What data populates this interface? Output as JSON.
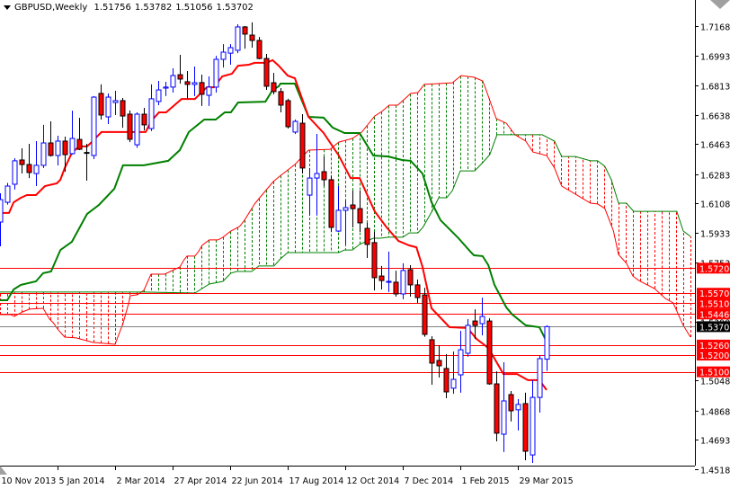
{
  "header": {
    "symbol_timeframe": "GBPUSD,Weekly",
    "open": "1.51756",
    "high": "1.53782",
    "low": "1.51056",
    "close": "1.53702"
  },
  "colors": {
    "bull": "#0000ff",
    "bear_fill": "#ff0000",
    "bear_outline": "#000000",
    "tenkan": "#ff0000",
    "kijun": "#008000",
    "span_a": "#ff0000",
    "span_b": "#008000",
    "level_line": "#ff0000",
    "current_price_line": "#808080",
    "current_price_label": "#000000"
  },
  "chart_data": {
    "type": "candlestick",
    "title": "GBPUSD,Weekly",
    "x_unit": "week index (0 = week of 10 Nov 2013)",
    "ylim": [
      1.4518,
      1.7168
    ],
    "grid": false,
    "x_labels": [
      {
        "week": 0,
        "label": "10 Nov 2013"
      },
      {
        "week": 8,
        "label": "5 Jan 2014"
      },
      {
        "week": 16,
        "label": "2 Mar 2014"
      },
      {
        "week": 24,
        "label": "27 Apr 2014"
      },
      {
        "week": 32,
        "label": "22 Jun 2014"
      },
      {
        "week": 40,
        "label": "17 Aug 2014"
      },
      {
        "week": 48,
        "label": "12 Oct 2014"
      },
      {
        "week": 56,
        "label": "7 Dec 2014"
      },
      {
        "week": 64,
        "label": "1 Feb 2015"
      },
      {
        "week": 72,
        "label": "29 Mar 2015"
      }
    ],
    "y_ticks": [
      "1.71680",
      "1.69930",
      "1.68130",
      "1.66380",
      "1.64630",
      "1.62830",
      "1.61080",
      "1.59330",
      "1.57530",
      "1.53980",
      "1.50480",
      "1.48680",
      "1.46930",
      "1.45180"
    ],
    "candles_ohlc": [
      [
        1.5996,
        1.6168,
        1.5851,
        1.613
      ],
      [
        1.6114,
        1.623,
        1.61,
        1.6211
      ],
      [
        1.6222,
        1.6378,
        1.619,
        1.6362
      ],
      [
        1.6367,
        1.6437,
        1.6286,
        1.634
      ],
      [
        1.634,
        1.6464,
        1.6259,
        1.6292
      ],
      [
        1.6286,
        1.648,
        1.6211,
        1.6335
      ],
      [
        1.6335,
        1.6577,
        1.6319,
        1.6469
      ],
      [
        1.6469,
        1.6598,
        1.6388,
        1.6394
      ],
      [
        1.6394,
        1.6512,
        1.6335,
        1.648
      ],
      [
        1.648,
        1.6507,
        1.6297,
        1.6399
      ],
      [
        1.6405,
        1.6662,
        1.6399,
        1.6496
      ],
      [
        1.649,
        1.6619,
        1.6426,
        1.6431
      ],
      [
        1.6412,
        1.6464,
        1.6243,
        1.6408
      ],
      [
        1.6394,
        1.6749,
        1.6372,
        1.6743
      ],
      [
        1.6765,
        1.6819,
        1.6609,
        1.6636
      ],
      [
        1.6625,
        1.6765,
        1.6582,
        1.6743
      ],
      [
        1.6711,
        1.6781,
        1.6636,
        1.6722
      ],
      [
        1.6722,
        1.6738,
        1.656,
        1.663
      ],
      [
        1.6641,
        1.6663,
        1.6474,
        1.6491
      ],
      [
        1.6458,
        1.6652,
        1.644,
        1.6641
      ],
      [
        1.6641,
        1.6679,
        1.6544,
        1.6577
      ],
      [
        1.6555,
        1.6819,
        1.654,
        1.6733
      ],
      [
        1.6717,
        1.684,
        1.6695,
        1.6786
      ],
      [
        1.6797,
        1.6835,
        1.6749,
        1.6803
      ],
      [
        1.6803,
        1.6915,
        1.677,
        1.6872
      ],
      [
        1.6877,
        1.6996,
        1.6824,
        1.6851
      ],
      [
        1.6835,
        1.6899,
        1.6733,
        1.6819
      ],
      [
        1.6819,
        1.6926,
        1.6749,
        1.6829
      ],
      [
        1.683,
        1.6878,
        1.669,
        1.676
      ],
      [
        1.6754,
        1.6867,
        1.669,
        1.6803
      ],
      [
        1.6803,
        1.699,
        1.677,
        1.6969
      ],
      [
        1.6969,
        1.706,
        1.692,
        1.7012
      ],
      [
        1.7006,
        1.706,
        1.6937,
        1.7039
      ],
      [
        1.7023,
        1.7179,
        1.7006,
        1.7163
      ],
      [
        1.7163,
        1.7168,
        1.7033,
        1.712
      ],
      [
        1.7114,
        1.719,
        1.7039,
        1.7082
      ],
      [
        1.7082,
        1.7103,
        1.6969,
        1.6974
      ],
      [
        1.6974,
        1.7001,
        1.6786,
        1.6808
      ],
      [
        1.6829,
        1.6888,
        1.676,
        1.6776
      ],
      [
        1.6776,
        1.6797,
        1.6652,
        1.6695
      ],
      [
        1.6722,
        1.6733,
        1.6555,
        1.6566
      ],
      [
        1.6534,
        1.6609,
        1.6523,
        1.6598
      ],
      [
        1.6587,
        1.6641,
        1.6286,
        1.6319
      ],
      [
        1.6157,
        1.6319,
        1.6034,
        1.6259
      ],
      [
        1.6259,
        1.6523,
        1.6034,
        1.6286
      ],
      [
        1.6297,
        1.6388,
        1.6211,
        1.6249
      ],
      [
        1.6249,
        1.6275,
        1.5937,
        1.5964
      ],
      [
        1.5942,
        1.6211,
        1.5937,
        1.6066
      ],
      [
        1.6066,
        1.6125,
        1.5862,
        1.6082
      ],
      [
        1.6098,
        1.6184,
        1.5964,
        1.6076
      ],
      [
        1.6076,
        1.6184,
        1.5937,
        1.5991
      ],
      [
        1.5958,
        1.5991,
        1.5781,
        1.5862
      ],
      [
        1.5873,
        1.5937,
        1.5587,
        1.5663
      ],
      [
        1.5673,
        1.5733,
        1.5593,
        1.5646
      ],
      [
        1.5636,
        1.5819,
        1.5577,
        1.5641
      ],
      [
        1.5636,
        1.5705,
        1.555,
        1.5566
      ],
      [
        1.5566,
        1.5749,
        1.5534,
        1.5706
      ],
      [
        1.5711,
        1.5738,
        1.555,
        1.562
      ],
      [
        1.562,
        1.5652,
        1.5512,
        1.5544
      ],
      [
        1.556,
        1.5603,
        1.531,
        1.5324
      ],
      [
        1.5292,
        1.5313,
        1.5023,
        1.5152
      ],
      [
        1.5168,
        1.5259,
        1.5066,
        1.5136
      ],
      [
        1.512,
        1.5206,
        1.4942,
        1.498
      ],
      [
        1.5002,
        1.5222,
        1.4969,
        1.5055
      ],
      [
        1.5082,
        1.5345,
        1.4975,
        1.5232
      ],
      [
        1.5211,
        1.5415,
        1.519,
        1.5378
      ],
      [
        1.5404,
        1.5474,
        1.5297,
        1.5377
      ],
      [
        1.5388,
        1.5544,
        1.5318,
        1.5431
      ],
      [
        1.5404,
        1.542,
        1.5023,
        1.5028
      ],
      [
        1.5028,
        1.5103,
        1.4684,
        1.4733
      ],
      [
        1.4727,
        1.5157,
        1.462,
        1.4926
      ],
      [
        1.4964,
        1.4985,
        1.4803,
        1.4867
      ],
      [
        1.4873,
        1.4937,
        1.4749,
        1.4905
      ],
      [
        1.491,
        1.4975,
        1.4571,
        1.4625
      ],
      [
        1.4603,
        1.505,
        1.4555,
        1.4947
      ],
      [
        1.4947,
        1.52,
        1.4856,
        1.5179
      ],
      [
        1.51756,
        1.53782,
        1.51056,
        1.53702
      ]
    ],
    "tenkan_sen": [
      [
        0,
        1.605
      ],
      [
        1.25,
        1.605
      ],
      [
        1.9,
        1.6114
      ],
      [
        2.9,
        1.6141
      ],
      [
        3.75,
        1.6157
      ],
      [
        5,
        1.6157
      ],
      [
        6.25,
        1.6211
      ],
      [
        7.9,
        1.6227
      ],
      [
        8.4,
        1.6249
      ],
      [
        9,
        1.6319
      ],
      [
        10,
        1.641
      ],
      [
        11,
        1.6448
      ],
      [
        12.1,
        1.6448
      ],
      [
        12.75,
        1.6474
      ],
      [
        14.1,
        1.6534
      ],
      [
        20.25,
        1.6534
      ],
      [
        21,
        1.6598
      ],
      [
        22.1,
        1.6652
      ],
      [
        23.1,
        1.6652
      ],
      [
        25.25,
        1.6732
      ],
      [
        27.1,
        1.6732
      ],
      [
        28.75,
        1.6802
      ],
      [
        29.75,
        1.6802
      ],
      [
        30.9,
        1.6867
      ],
      [
        32.25,
        1.6883
      ],
      [
        33.1,
        1.6931
      ],
      [
        34.6,
        1.6937
      ],
      [
        35.4,
        1.6948
      ],
      [
        37.1,
        1.6948
      ],
      [
        37.9,
        1.6964
      ],
      [
        38.75,
        1.6931
      ],
      [
        40,
        1.6872
      ],
      [
        41,
        1.6856
      ],
      [
        42.9,
        1.6625
      ],
      [
        45,
        1.6528
      ],
      [
        47.1,
        1.6394
      ],
      [
        48.75,
        1.6259
      ],
      [
        50,
        1.6259
      ],
      [
        52.1,
        1.606
      ],
      [
        53.75,
        1.5964
      ],
      [
        55.4,
        1.5883
      ],
      [
        56.9,
        1.5856
      ],
      [
        57.9,
        1.5845
      ],
      [
        58.75,
        1.5727
      ],
      [
        60,
        1.548
      ],
      [
        62.5,
        1.5367
      ],
      [
        65,
        1.5362
      ],
      [
        66.25,
        1.5297
      ],
      [
        67.9,
        1.5243
      ],
      [
        70,
        1.5087
      ],
      [
        71.9,
        1.5087
      ],
      [
        73.4,
        1.505
      ],
      [
        75,
        1.505
      ],
      [
        76,
        1.4991
      ]
    ],
    "kijun_sen": [
      [
        0,
        1.5528
      ],
      [
        1,
        1.5528
      ],
      [
        1.9,
        1.5593
      ],
      [
        2.9,
        1.562
      ],
      [
        5,
        1.5641
      ],
      [
        6,
        1.569
      ],
      [
        7.1,
        1.57
      ],
      [
        8.4,
        1.5829
      ],
      [
        10,
        1.5878
      ],
      [
        12.1,
        1.6044
      ],
      [
        13.75,
        1.6098
      ],
      [
        15.9,
        1.6195
      ],
      [
        17.1,
        1.6335
      ],
      [
        20,
        1.6335
      ],
      [
        23.4,
        1.6362
      ],
      [
        25,
        1.6426
      ],
      [
        26.25,
        1.6534
      ],
      [
        28.4,
        1.6609
      ],
      [
        30,
        1.6609
      ],
      [
        31.25,
        1.6652
      ],
      [
        32.1,
        1.6652
      ],
      [
        33.1,
        1.6711
      ],
      [
        36.9,
        1.6716
      ],
      [
        37.9,
        1.6786
      ],
      [
        38.75,
        1.6808
      ],
      [
        39,
        1.6824
      ],
      [
        41,
        1.6824
      ],
      [
        42.9,
        1.6625
      ],
      [
        45,
        1.662
      ],
      [
        46.25,
        1.6561
      ],
      [
        47.9,
        1.6528
      ],
      [
        50,
        1.6528
      ],
      [
        51.9,
        1.6394
      ],
      [
        54,
        1.6388
      ],
      [
        55.9,
        1.6367
      ],
      [
        57.1,
        1.6362
      ],
      [
        58.75,
        1.6286
      ],
      [
        60,
        1.6114
      ],
      [
        61.25,
        1.6007
      ],
      [
        63.75,
        1.5899
      ],
      [
        65.4,
        1.5819
      ],
      [
        65.9,
        1.5797
      ],
      [
        67.1,
        1.5792
      ],
      [
        67.9,
        1.5738
      ],
      [
        68.75,
        1.562
      ],
      [
        70.4,
        1.5485
      ],
      [
        71.25,
        1.5442
      ],
      [
        73.1,
        1.5378
      ],
      [
        75,
        1.5367
      ],
      [
        76,
        1.5281
      ]
    ],
    "senkou_span_a": [
      [
        0,
        1.5442
      ],
      [
        1.5,
        1.5442
      ],
      [
        2,
        1.5432
      ],
      [
        3.1,
        1.5458
      ],
      [
        4.1,
        1.5475
      ],
      [
        6,
        1.548
      ],
      [
        6.9,
        1.5415
      ],
      [
        7.4,
        1.5394
      ],
      [
        8.1,
        1.5351
      ],
      [
        9,
        1.5308
      ],
      [
        10.6,
        1.5303
      ],
      [
        12.9,
        1.5276
      ],
      [
        16,
        1.5265
      ],
      [
        17.1,
        1.5389
      ],
      [
        17.9,
        1.5512
      ],
      [
        18.1,
        1.5555
      ],
      [
        19.1,
        1.5561
      ],
      [
        20,
        1.5587
      ],
      [
        21,
        1.5684
      ],
      [
        22.9,
        1.5684
      ],
      [
        25,
        1.5727
      ],
      [
        25.6,
        1.577
      ],
      [
        26,
        1.5792
      ],
      [
        27.1,
        1.5792
      ],
      [
        27.6,
        1.5819
      ],
      [
        28.1,
        1.5856
      ],
      [
        29.1,
        1.5889
      ],
      [
        30.3,
        1.5889
      ],
      [
        31,
        1.5905
      ],
      [
        32.1,
        1.5942
      ],
      [
        33.3,
        1.5969
      ],
      [
        34,
        1.6007
      ],
      [
        35.4,
        1.6104
      ],
      [
        36,
        1.6136
      ],
      [
        38,
        1.6238
      ],
      [
        38.9,
        1.627
      ],
      [
        41,
        1.634
      ],
      [
        42.9,
        1.6426
      ],
      [
        45.9,
        1.6431
      ],
      [
        47.1,
        1.6474
      ],
      [
        49,
        1.6496
      ],
      [
        50.3,
        1.6534
      ],
      [
        52.1,
        1.663
      ],
      [
        53.1,
        1.6657
      ],
      [
        54.1,
        1.6695
      ],
      [
        55.3,
        1.6695
      ],
      [
        56,
        1.6722
      ],
      [
        57.1,
        1.6765
      ],
      [
        58.1,
        1.677
      ],
      [
        59,
        1.6819
      ],
      [
        62.9,
        1.6829
      ],
      [
        64.1,
        1.6872
      ],
      [
        65.9,
        1.6862
      ],
      [
        67.1,
        1.684
      ],
      [
        67.5,
        1.6797
      ],
      [
        69,
        1.6614
      ],
      [
        70.4,
        1.6587
      ],
      [
        71.6,
        1.6518
      ],
      [
        73.1,
        1.648
      ],
      [
        74.1,
        1.6415
      ],
      [
        76,
        1.6394
      ],
      [
        77.1,
        1.6319
      ],
      [
        78.1,
        1.6211
      ],
      [
        80,
        1.6163
      ],
      [
        82.1,
        1.6109
      ],
      [
        83.1,
        1.6104
      ],
      [
        84.1,
        1.6077
      ],
      [
        85.3,
        1.5942
      ],
      [
        86,
        1.5802
      ],
      [
        87.1,
        1.5749
      ],
      [
        88,
        1.5673
      ],
      [
        88.8,
        1.5647
      ],
      [
        91,
        1.5598
      ],
      [
        92.5,
        1.5539
      ],
      [
        93.6,
        1.5512
      ],
      [
        95,
        1.5378
      ],
      [
        96,
        1.5308
      ]
    ],
    "senkou_span_b": [
      [
        0,
        1.5577
      ],
      [
        20,
        1.5577
      ],
      [
        27.1,
        1.5571
      ],
      [
        29.1,
        1.5625
      ],
      [
        31,
        1.5641
      ],
      [
        32.1,
        1.569
      ],
      [
        32.9,
        1.57
      ],
      [
        35,
        1.57
      ],
      [
        36,
        1.5733
      ],
      [
        38.1,
        1.5733
      ],
      [
        39,
        1.5776
      ],
      [
        40,
        1.5813
      ],
      [
        47.1,
        1.5813
      ],
      [
        47.9,
        1.5829
      ],
      [
        49,
        1.5829
      ],
      [
        50,
        1.5862
      ],
      [
        51.9,
        1.5899
      ],
      [
        52.9,
        1.5899
      ],
      [
        54,
        1.5905
      ],
      [
        56,
        1.5905
      ],
      [
        56.9,
        1.5931
      ],
      [
        58.1,
        1.5931
      ],
      [
        58.8,
        1.5964
      ],
      [
        60,
        1.6055
      ],
      [
        61,
        1.6141
      ],
      [
        62.1,
        1.6141
      ],
      [
        62.9,
        1.6184
      ],
      [
        64,
        1.6302
      ],
      [
        66,
        1.6302
      ],
      [
        67.1,
        1.6351
      ],
      [
        68.1,
        1.6399
      ],
      [
        69.1,
        1.6518
      ],
      [
        75.4,
        1.6518
      ],
      [
        77.1,
        1.648
      ],
      [
        78.1,
        1.6388
      ],
      [
        80,
        1.6388
      ],
      [
        82.1,
        1.6362
      ],
      [
        83.1,
        1.6362
      ],
      [
        84.1,
        1.6329
      ],
      [
        85,
        1.6249
      ],
      [
        86,
        1.6109
      ],
      [
        87.1,
        1.6109
      ],
      [
        88.1,
        1.606
      ],
      [
        94.1,
        1.606
      ],
      [
        95,
        1.5942
      ],
      [
        96,
        1.591
      ]
    ],
    "horizontal_levels": [
      "1.57200",
      "1.55700",
      "1.55100",
      "1.54460",
      "1.52600",
      "1.52000",
      "1.51000"
    ],
    "current_price": "1.53702"
  }
}
